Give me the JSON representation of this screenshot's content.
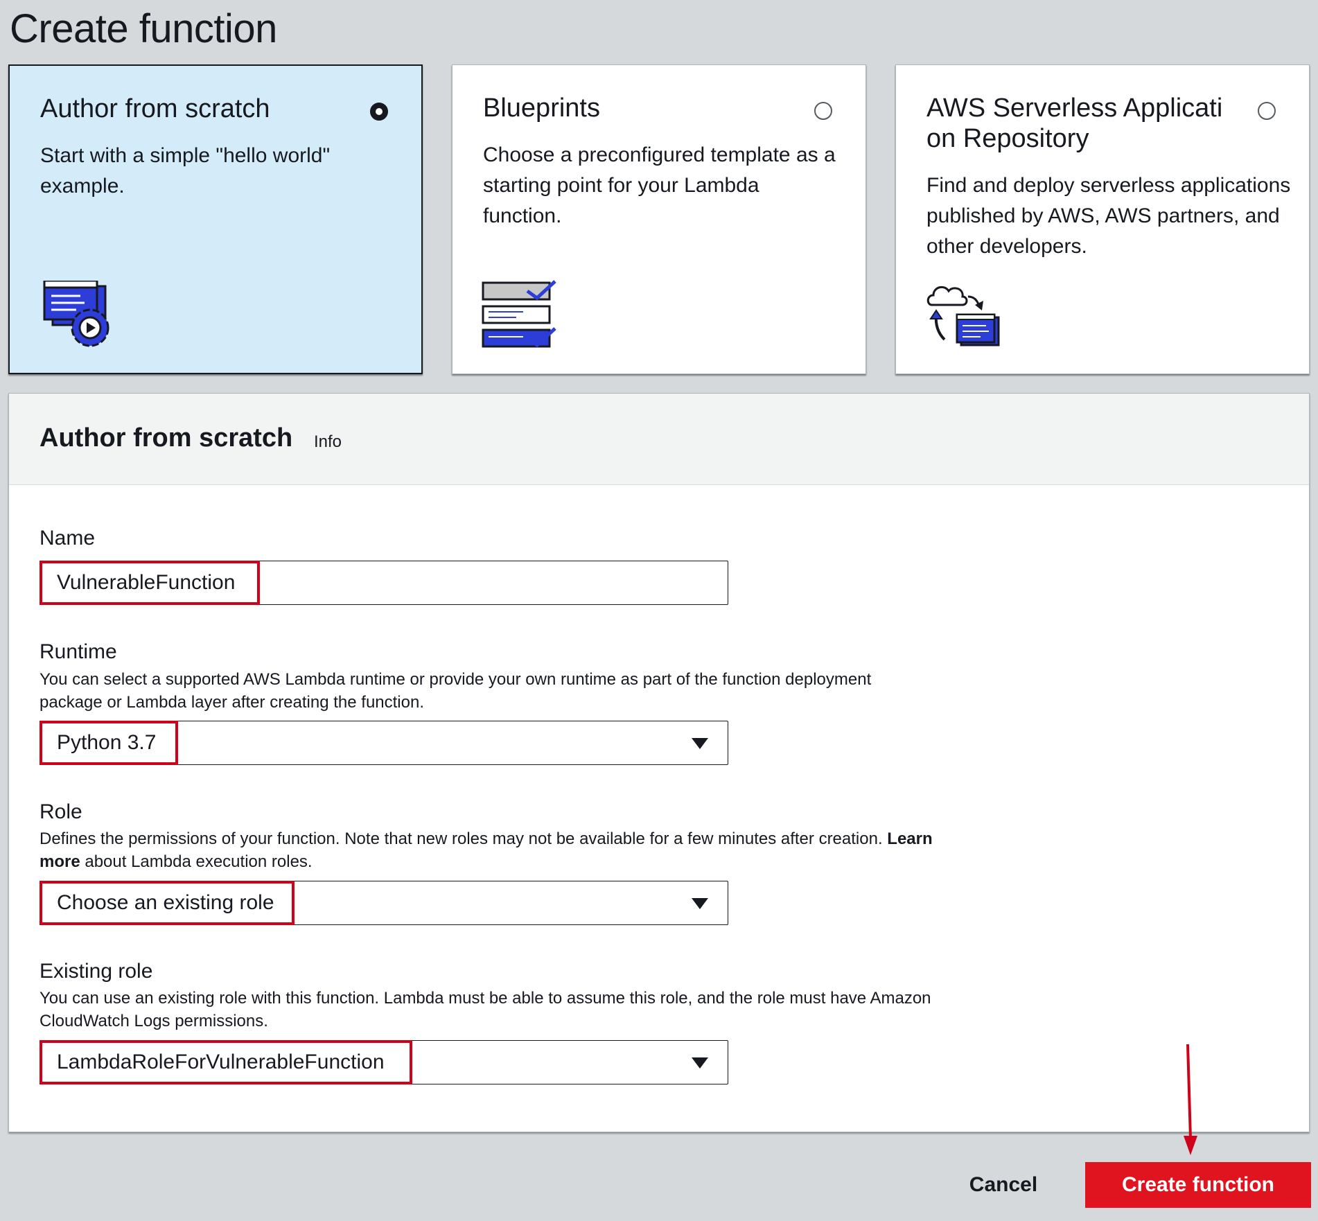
{
  "page": {
    "title": "Create function"
  },
  "options": [
    {
      "title": "Author from scratch",
      "description": "Start with a simple \"hello world\" example.",
      "selected": true,
      "icon": "editor-gear-icon"
    },
    {
      "title": "Blueprints",
      "description": "Choose a preconfigured template as a starting point for your Lambda function.",
      "selected": false,
      "icon": "blueprint-checklist-icon"
    },
    {
      "title": "AWS Serverless Applicati on Repository",
      "description": "Find and deploy serverless applications published by AWS, AWS partners, and other developers.",
      "selected": false,
      "icon": "cloud-sync-icon"
    }
  ],
  "form": {
    "title": "Author from scratch",
    "info_label": "Info",
    "name": {
      "label": "Name",
      "value": "VulnerableFunction"
    },
    "runtime": {
      "label": "Runtime",
      "description": "You can select a supported AWS Lambda runtime or provide your own runtime as part of the function deployment package or Lambda layer after creating the function.",
      "value": "Python 3.7"
    },
    "role": {
      "label": "Role",
      "description_before": "Defines the permissions of your function. Note that new roles may not be available for a few minutes after creation.",
      "description_link": "Learn more",
      "description_after": "about Lambda execution roles.",
      "value": "Choose an existing role"
    },
    "existing_role": {
      "label": "Existing role",
      "description": "You can use an existing role with this function. Lambda must be able to assume this role, and the role must have Amazon CloudWatch Logs permissions.",
      "value": "LambdaRoleForVulnerableFunction"
    }
  },
  "actions": {
    "cancel": "Cancel",
    "create": "Create function"
  },
  "colors": {
    "selected_card": "#d4ecfa",
    "primary_button": "#e0141e",
    "highlight": "#d0021b",
    "icon_blue": "#2d3dd8"
  }
}
